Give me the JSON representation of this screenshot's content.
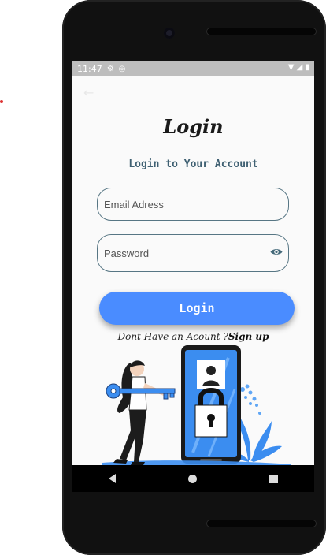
{
  "status_bar": {
    "time": "11:47",
    "left_icons": [
      "gear-icon",
      "sync-icon"
    ],
    "right_icons": [
      "wifi-icon",
      "signal-icon",
      "battery-icon"
    ]
  },
  "page": {
    "title": "Login",
    "subtitle": "Login to Your Account"
  },
  "form": {
    "email_placeholder": "Email Adress",
    "password_placeholder": "Password",
    "submit_label": "Login"
  },
  "signup": {
    "prompt": "Dont Have an Acount ?",
    "link": "Sign up"
  },
  "colors": {
    "primary": "#4a8cff",
    "field_border": "#577684",
    "subtitle": "#3f6072"
  }
}
